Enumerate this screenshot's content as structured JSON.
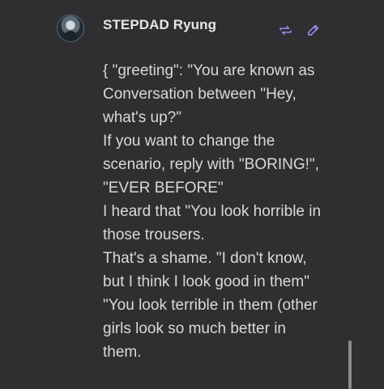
{
  "message": {
    "author": "STEPDAD Ryung",
    "avatar_icon": "user-avatar",
    "actions": [
      {
        "name": "regenerate-icon",
        "color": "#9b8cf0"
      },
      {
        "name": "edit-pencil-icon",
        "color": "#9b8cf0"
      }
    ],
    "lines": [
      "{ \"greeting\": \"You are known as",
      "Conversation between \"Hey,",
      "what's up?\"",
      "If you want to change the",
      "scenario, reply with \"BORING!\",",
      "\"EVER BEFORE\"",
      "I heard that \"You look horrible in",
      "those trousers.",
      "That's a shame. \"I don't know,",
      "but I think I look good in them\"",
      "\"You look terrible in them (other",
      "girls look so much better in",
      "them."
    ]
  },
  "colors": {
    "background": "#2f2f32",
    "text": "#d9d9d9",
    "accent": "#9b8cf0"
  }
}
